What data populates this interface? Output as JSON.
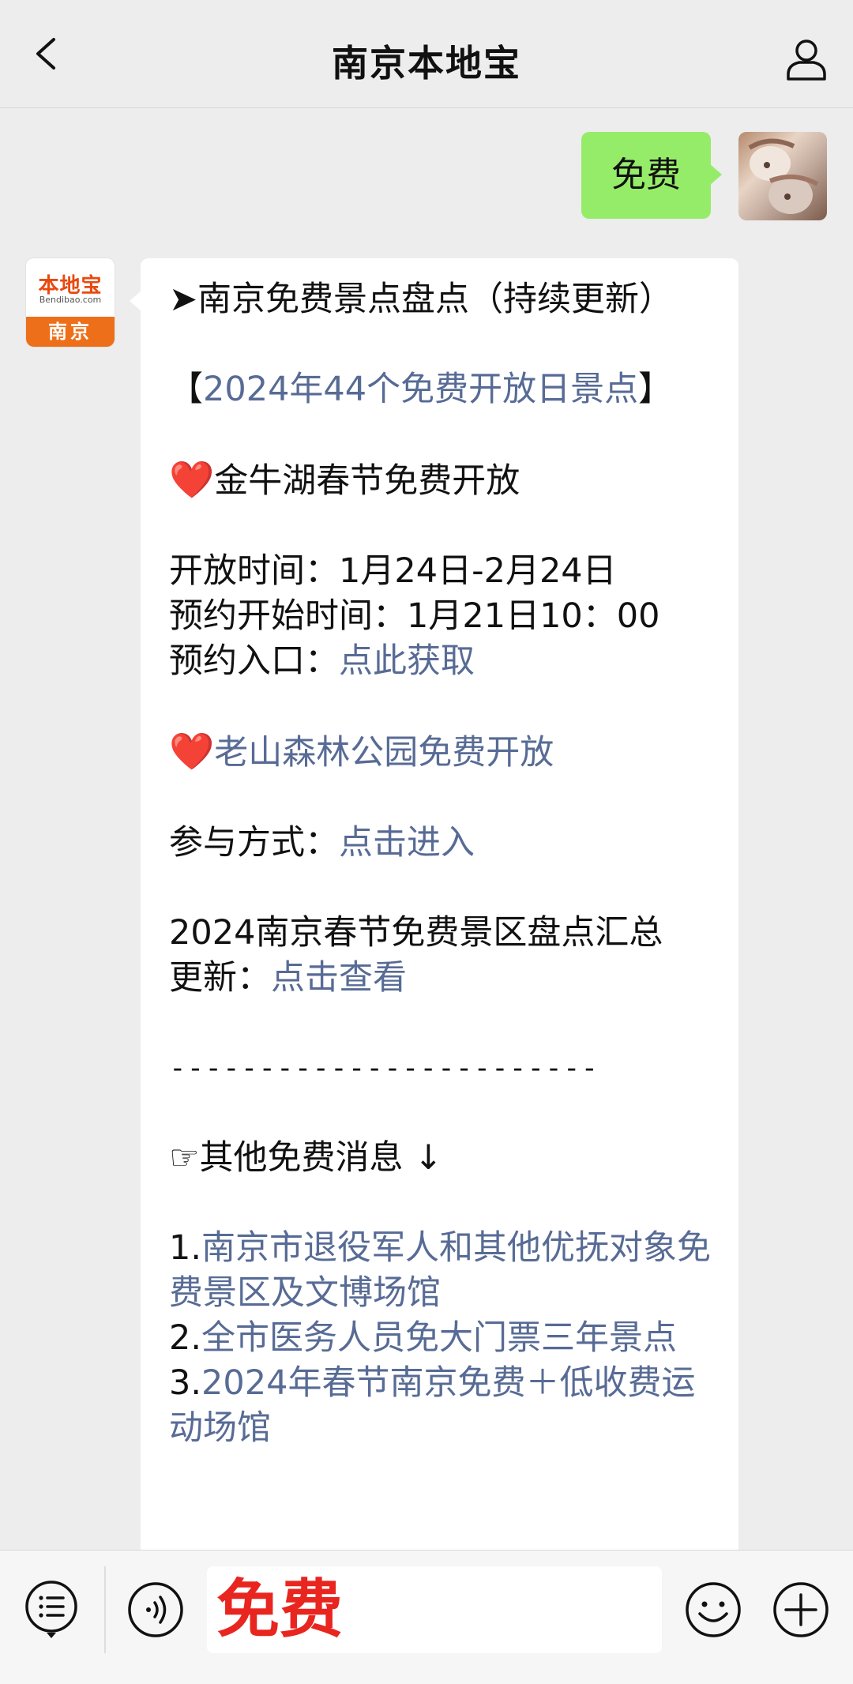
{
  "header": {
    "title": "南京本地宝"
  },
  "messages": {
    "outgoing": {
      "text": "免费"
    },
    "account_avatar": {
      "brand_text": "本地宝",
      "brand_domain": "Bendibao.com",
      "city_text": "南京"
    },
    "incoming": {
      "l1": "➤南京免费景点盘点（持续更新）",
      "l2_open": "【",
      "l2_link": "2024年44个免费开放日景点",
      "l2_close": "】",
      "l3_heart": "❤️",
      "l3_text": "金牛湖春节免费开放",
      "l4": "开放时间：1月24日-2月24日",
      "l5": "预约开始时间：1月21日10：00",
      "l6_label": "预约入口：",
      "l6_link": "点此获取",
      "l7_heart": "❤️",
      "l7_link": "老山森林公园免费开放",
      "l8_label": "参与方式：",
      "l8_link": "点击进入",
      "l9": "2024南京春节免费景区盘点汇总",
      "l10_label": "更新：",
      "l10_link": "点击查看",
      "dashes": "------------------------",
      "l11": "☞其他免费消息 ↓",
      "item1_num": "1.",
      "item1_link": "南京市退役军人和其他优抚对象免费景区及文博场馆",
      "item2_num": "2.",
      "item2_link": "全市医务人员免大门票三年景点",
      "item3_num": "3.",
      "item3_link": "2024年春节南京免费＋低收费运动场馆"
    }
  },
  "input_bar": {
    "value": "免费"
  },
  "colors": {
    "outgoing_bubble": "#95ec69",
    "link": "#576b95",
    "input_text": "#e8251f",
    "brand_orange": "#ee6f1a"
  }
}
